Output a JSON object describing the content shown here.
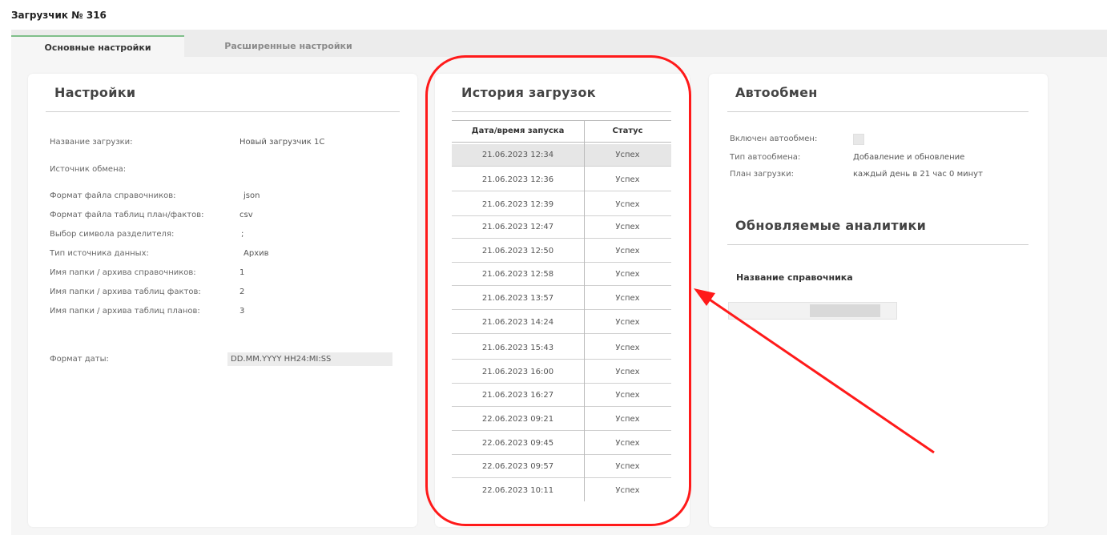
{
  "window": {
    "title": "Загрузчик № 316"
  },
  "tabs": {
    "main": "Основные настройки",
    "advanced": "Расширенные настройки"
  },
  "settings": {
    "title": "Настройки",
    "rows": [
      {
        "label": "Название загрузки:",
        "value": "Новый загрузчик 1С"
      },
      {
        "label": "Источник обмена:",
        "value": ""
      },
      {
        "label": "Формат файла справочников:",
        "value": "json"
      },
      {
        "label": "Формат файла таблиц план/фактов:",
        "value": "csv"
      },
      {
        "label": "Выбор символа разделителя:",
        "value": ";"
      },
      {
        "label": "Тип источника данных:",
        "value": "Архив"
      },
      {
        "label": "Имя папки / архива справочников:",
        "value": "1"
      },
      {
        "label": "Имя папки / архива таблиц фактов:",
        "value": "2"
      },
      {
        "label": "Имя папки / архива таблиц планов:",
        "value": "3"
      },
      {
        "label": "Формат даты:",
        "value": "DD.MM.YYYY HH24:MI:SS"
      }
    ]
  },
  "history": {
    "title": "История загрузок",
    "columns": [
      "Дата/время запуска",
      "Статус"
    ],
    "rows": [
      {
        "date": "21.06.2023 12:34",
        "status": "Успех"
      },
      {
        "date": "21.06.2023 12:36",
        "status": "Успех"
      },
      {
        "date": "21.06.2023 12:39",
        "status": "Успех"
      },
      {
        "date": "21.06.2023 12:47",
        "status": "Успех"
      },
      {
        "date": "21.06.2023 12:50",
        "status": "Успех"
      },
      {
        "date": "21.06.2023 12:58",
        "status": "Успех"
      },
      {
        "date": "21.06.2023 13:57",
        "status": "Успех"
      },
      {
        "date": "21.06.2023 14:24",
        "status": "Успех"
      },
      {
        "date": "21.06.2023 15:43",
        "status": "Успех"
      },
      {
        "date": "21.06.2023 16:00",
        "status": "Успех"
      },
      {
        "date": "21.06.2023 16:27",
        "status": "Успех"
      },
      {
        "date": "22.06.2023 09:21",
        "status": "Успех"
      },
      {
        "date": "22.06.2023 09:45",
        "status": "Успех"
      },
      {
        "date": "22.06.2023 09:57",
        "status": "Успех"
      },
      {
        "date": "22.06.2023 10:11",
        "status": "Успех"
      }
    ]
  },
  "autoexchange": {
    "title": "Автообмен",
    "enabled_label": "Включен автообмен:",
    "type_label": "Тип автообмена:",
    "type_value": "Добавление и обновление",
    "plan_label": "План загрузки:",
    "plan_value": "каждый день в 21 час 0 минут"
  },
  "analytics": {
    "title": "Обновляемые аналитики",
    "column": "Название справочника"
  },
  "colors": {
    "annotation": "#ff1a1a",
    "tab_accent": "#7fbf8a"
  }
}
